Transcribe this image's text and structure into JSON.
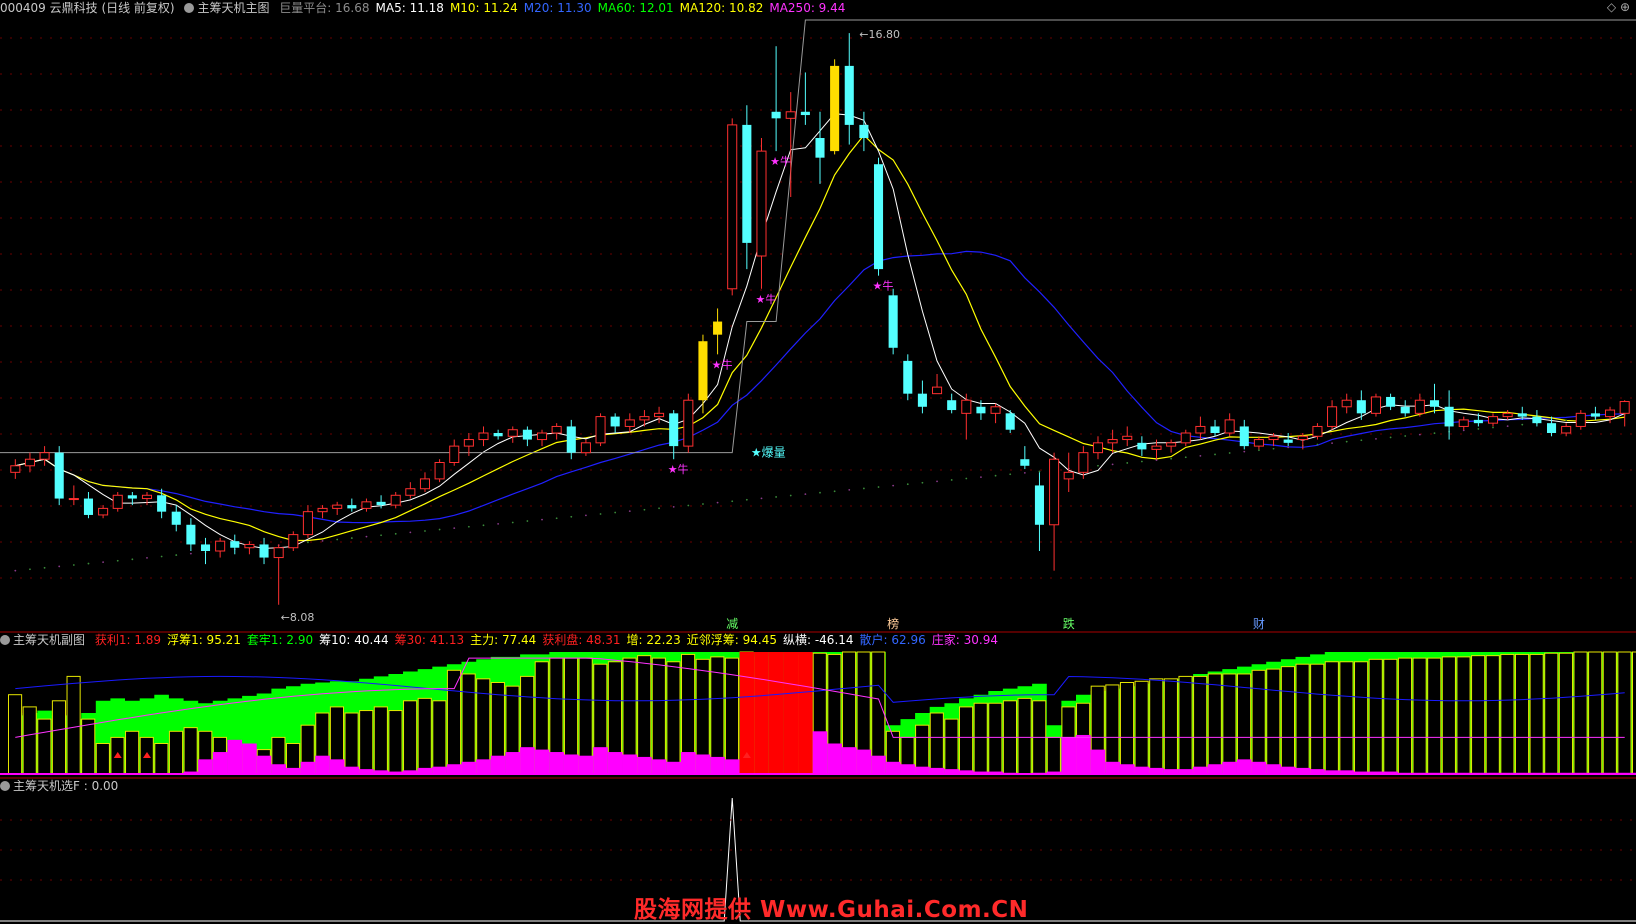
{
  "main_header": {
    "code_name": "000409 云鼎科技 (日线 前复权)",
    "indicator": "主筹天机主图",
    "items": [
      {
        "label": "巨量平台: 16.68",
        "color": "#8c8c8c"
      },
      {
        "label": "MA5: 11.18",
        "color": "#ffffff"
      },
      {
        "label": "M10: 11.24",
        "color": "#ffff00"
      },
      {
        "label": "M20: 11.30",
        "color": "#3366ff"
      },
      {
        "label": "MA60: 12.01",
        "color": "#00ff00"
      },
      {
        "label": "MA120: 10.82",
        "color": "#ffff00"
      },
      {
        "label": "MA250: 9.44",
        "color": "#ff33ff"
      }
    ]
  },
  "main_chart": {
    "high_label": "16.80",
    "low_label": "8.08",
    "volume_label": "爆量",
    "signal_label": "牛",
    "bottom_markers": [
      "减",
      "榜",
      "跌",
      "财"
    ]
  },
  "sub_header": {
    "indicator": "主筹天机副图",
    "items": [
      {
        "label": "获利1: 1.89",
        "color": "#ff2020"
      },
      {
        "label": "浮筹1: 95.21",
        "color": "#ffff00"
      },
      {
        "label": "套牢1: 2.90",
        "color": "#00ff00"
      },
      {
        "label": "筹10: 40.44",
        "color": "#ffffff"
      },
      {
        "label": "筹30: 41.13",
        "color": "#ff2020"
      },
      {
        "label": "主力: 77.44",
        "color": "#ffff00"
      },
      {
        "label": "获利盘: 48.31",
        "color": "#ff2020"
      },
      {
        "label": "增: 22.23",
        "color": "#ffff00"
      },
      {
        "label": "近邻浮筹: 94.45",
        "color": "#ffff00"
      },
      {
        "label": "纵横: -46.14",
        "color": "#ffffff"
      },
      {
        "label": "散户: 62.96",
        "color": "#3366ff"
      },
      {
        "label": "庄家: 30.94",
        "color": "#ff33ff"
      }
    ]
  },
  "sel_header": {
    "indicator": "主筹天机选F : 0.00"
  },
  "watermark": "股海网提供 Www.Guhai.Com.CN",
  "colors": {
    "up": "#ff3030",
    "down": "#54ffff",
    "ma5": "#ffffff",
    "ma10": "#ffff00",
    "ma20": "#2020ff",
    "platform": "#9a9a9a",
    "sub_green": "#00ff00",
    "sub_magenta": "#ff00ff",
    "sub_red": "#ff0000"
  },
  "chart_data": {
    "type": "candlestick",
    "ohlc": [
      [
        10.1,
        10.3,
        10.0,
        10.2
      ],
      [
        10.2,
        10.4,
        10.1,
        10.3
      ],
      [
        10.3,
        10.5,
        10.2,
        10.4
      ],
      [
        10.4,
        10.5,
        9.6,
        9.7
      ],
      [
        9.7,
        9.9,
        9.6,
        9.7
      ],
      [
        9.7,
        9.8,
        9.4,
        9.45
      ],
      [
        9.45,
        9.6,
        9.4,
        9.55
      ],
      [
        9.55,
        9.8,
        9.5,
        9.75
      ],
      [
        9.75,
        9.8,
        9.6,
        9.7
      ],
      [
        9.7,
        9.8,
        9.6,
        9.75
      ],
      [
        9.75,
        9.85,
        9.4,
        9.5
      ],
      [
        9.5,
        9.6,
        9.2,
        9.3
      ],
      [
        9.3,
        9.4,
        8.9,
        9.0
      ],
      [
        9.0,
        9.1,
        8.7,
        8.9
      ],
      [
        8.9,
        9.1,
        8.8,
        9.05
      ],
      [
        9.05,
        9.15,
        8.85,
        8.95
      ],
      [
        8.95,
        9.05,
        8.85,
        9.0
      ],
      [
        9.0,
        9.1,
        8.7,
        8.8
      ],
      [
        8.8,
        9.0,
        8.08,
        8.95
      ],
      [
        8.95,
        9.2,
        8.9,
        9.15
      ],
      [
        9.15,
        9.6,
        9.1,
        9.5
      ],
      [
        9.5,
        9.6,
        9.4,
        9.55
      ],
      [
        9.55,
        9.65,
        9.45,
        9.6
      ],
      [
        9.6,
        9.7,
        9.5,
        9.55
      ],
      [
        9.55,
        9.7,
        9.5,
        9.65
      ],
      [
        9.65,
        9.75,
        9.55,
        9.6
      ],
      [
        9.6,
        9.8,
        9.55,
        9.75
      ],
      [
        9.75,
        9.95,
        9.7,
        9.85
      ],
      [
        9.85,
        10.1,
        9.8,
        10.0
      ],
      [
        10.0,
        10.3,
        9.95,
        10.25
      ],
      [
        10.25,
        10.6,
        10.2,
        10.5
      ],
      [
        10.5,
        10.7,
        10.35,
        10.6
      ],
      [
        10.6,
        10.8,
        10.5,
        10.7
      ],
      [
        10.7,
        10.75,
        10.6,
        10.65
      ],
      [
        10.65,
        10.8,
        10.55,
        10.75
      ],
      [
        10.75,
        10.8,
        10.5,
        10.6
      ],
      [
        10.6,
        10.75,
        10.5,
        10.7
      ],
      [
        10.7,
        10.85,
        10.6,
        10.8
      ],
      [
        10.8,
        10.9,
        10.3,
        10.4
      ],
      [
        10.4,
        10.6,
        10.35,
        10.55
      ],
      [
        10.55,
        11.0,
        10.5,
        10.95
      ],
      [
        10.95,
        11.0,
        10.7,
        10.8
      ],
      [
        10.8,
        11.0,
        10.7,
        10.9
      ],
      [
        10.9,
        11.05,
        10.8,
        10.95
      ],
      [
        10.95,
        11.1,
        10.85,
        11.0
      ],
      [
        11.0,
        11.05,
        10.3,
        10.5
      ],
      [
        10.5,
        11.3,
        10.4,
        11.2
      ],
      [
        11.2,
        12.2,
        11.0,
        12.1
      ],
      [
        12.2,
        12.6,
        11.9,
        12.4
      ],
      [
        12.9,
        15.5,
        12.8,
        15.4
      ],
      [
        15.4,
        15.7,
        13.2,
        13.6
      ],
      [
        13.4,
        15.2,
        12.9,
        15.0
      ],
      [
        15.6,
        16.6,
        15.0,
        15.5
      ],
      [
        15.5,
        15.9,
        14.3,
        15.6
      ],
      [
        15.6,
        16.2,
        15.4,
        15.55
      ],
      [
        15.2,
        15.6,
        14.5,
        14.9
      ],
      [
        15.0,
        16.4,
        14.95,
        16.3
      ],
      [
        16.3,
        16.8,
        15.1,
        15.4
      ],
      [
        15.4,
        15.6,
        15.0,
        15.2
      ],
      [
        14.8,
        14.9,
        13.1,
        13.2
      ],
      [
        12.8,
        12.9,
        11.9,
        12.0
      ],
      [
        11.8,
        11.9,
        11.2,
        11.3
      ],
      [
        11.3,
        11.5,
        11.0,
        11.1
      ],
      [
        11.3,
        11.6,
        11.3,
        11.4
      ],
      [
        11.2,
        11.3,
        11.0,
        11.05
      ],
      [
        11.0,
        11.3,
        10.6,
        11.2
      ],
      [
        11.1,
        11.2,
        10.9,
        11.0
      ],
      [
        11.0,
        11.15,
        10.85,
        11.1
      ],
      [
        11.0,
        11.05,
        10.7,
        10.75
      ],
      [
        10.3,
        10.5,
        10.15,
        10.2
      ],
      [
        9.9,
        10.1,
        8.9,
        9.3
      ],
      [
        9.3,
        10.4,
        8.6,
        10.3
      ],
      [
        10.0,
        10.4,
        9.8,
        10.1
      ],
      [
        10.1,
        10.5,
        10.0,
        10.4
      ],
      [
        10.4,
        10.65,
        10.3,
        10.55
      ],
      [
        10.55,
        10.75,
        10.4,
        10.6
      ],
      [
        10.6,
        10.8,
        10.5,
        10.65
      ],
      [
        10.55,
        10.65,
        10.35,
        10.45
      ],
      [
        10.45,
        10.6,
        10.3,
        10.5
      ],
      [
        10.5,
        10.6,
        10.4,
        10.55
      ],
      [
        10.55,
        10.75,
        10.5,
        10.7
      ],
      [
        10.7,
        10.95,
        10.6,
        10.8
      ],
      [
        10.8,
        10.9,
        10.65,
        10.7
      ],
      [
        10.7,
        11.0,
        10.65,
        10.9
      ],
      [
        10.8,
        10.9,
        10.45,
        10.5
      ],
      [
        10.5,
        10.65,
        10.45,
        10.6
      ],
      [
        10.6,
        10.7,
        10.5,
        10.65
      ],
      [
        10.6,
        10.7,
        10.5,
        10.55
      ],
      [
        10.6,
        10.7,
        10.45,
        10.65
      ],
      [
        10.65,
        10.85,
        10.6,
        10.8
      ],
      [
        10.8,
        11.2,
        10.75,
        11.1
      ],
      [
        11.1,
        11.3,
        11.0,
        11.2
      ],
      [
        11.2,
        11.35,
        10.9,
        11.0
      ],
      [
        11.0,
        11.3,
        10.95,
        11.25
      ],
      [
        11.25,
        11.3,
        11.05,
        11.1
      ],
      [
        11.1,
        11.2,
        10.95,
        11.0
      ],
      [
        11.0,
        11.3,
        10.95,
        11.2
      ],
      [
        11.2,
        11.45,
        11.0,
        11.1
      ],
      [
        11.1,
        11.35,
        10.6,
        10.8
      ],
      [
        10.8,
        10.95,
        10.75,
        10.9
      ],
      [
        10.9,
        11.0,
        10.8,
        10.85
      ],
      [
        10.85,
        11.0,
        10.8,
        10.95
      ],
      [
        10.95,
        11.05,
        10.9,
        11.0
      ],
      [
        11.0,
        11.1,
        10.9,
        10.95
      ],
      [
        10.95,
        11.05,
        10.8,
        10.85
      ],
      [
        10.85,
        10.95,
        10.65,
        10.7
      ],
      [
        10.7,
        10.85,
        10.65,
        10.8
      ],
      [
        10.8,
        11.05,
        10.75,
        11.0
      ],
      [
        11.0,
        11.1,
        10.9,
        10.95
      ],
      [
        10.95,
        11.1,
        10.85,
        11.05
      ],
      [
        11.0,
        11.2,
        10.8,
        11.18
      ]
    ],
    "ylim": [
      8.0,
      17.0
    ],
    "volume_bars": [
      65,
      55,
      45,
      60,
      80,
      45,
      25,
      30,
      35,
      30,
      25,
      35,
      38,
      35,
      30,
      25,
      22,
      20,
      30,
      25,
      40,
      50,
      55,
      50,
      52,
      55,
      52,
      60,
      62,
      60,
      85,
      82,
      78,
      75,
      72,
      80,
      92,
      95,
      95,
      95,
      90,
      92,
      95,
      97,
      95,
      92,
      98,
      94,
      96,
      95,
      100,
      96,
      96,
      98,
      97,
      99,
      98,
      100,
      100,
      100,
      35,
      30,
      40,
      50,
      45,
      55,
      58,
      58,
      60,
      62,
      60,
      30,
      55,
      58,
      72,
      73,
      75,
      76,
      78,
      78,
      80,
      80,
      82,
      82,
      82,
      85,
      86,
      88,
      90,
      90,
      92,
      92,
      92,
      94,
      94,
      95,
      95,
      95,
      96,
      96,
      97,
      97,
      98,
      98,
      98,
      99,
      99,
      100,
      100,
      100,
      100,
      100,
      100
    ],
    "green_floor": [
      48,
      50,
      52,
      48,
      45,
      50,
      60,
      62,
      60,
      62,
      65,
      62,
      60,
      58,
      60,
      62,
      64,
      66,
      70,
      72,
      74,
      75,
      76,
      76,
      78,
      80,
      82,
      84,
      86,
      88,
      90,
      92,
      94,
      96,
      96,
      98,
      98,
      100,
      100,
      100,
      100,
      100,
      100,
      100,
      100,
      100,
      100,
      100,
      100,
      100,
      100,
      100,
      100,
      100,
      100,
      100,
      100,
      100,
      100,
      100,
      40,
      45,
      50,
      55,
      58,
      62,
      65,
      68,
      70,
      72,
      74,
      40,
      60,
      65,
      68,
      70,
      72,
      74,
      76,
      78,
      80,
      82,
      84,
      86,
      88,
      90,
      92,
      94,
      96,
      98,
      100,
      100,
      100,
      100,
      100,
      100,
      100,
      100,
      100,
      100,
      100,
      100,
      100,
      100,
      100,
      100,
      100,
      100,
      100,
      100,
      100,
      100,
      100
    ],
    "magenta_area": [
      0,
      0,
      0,
      0,
      0,
      0,
      0,
      0,
      0,
      0,
      0,
      0,
      2,
      12,
      18,
      28,
      25,
      15,
      8,
      5,
      10,
      15,
      12,
      6,
      4,
      3,
      2,
      3,
      5,
      6,
      8,
      10,
      12,
      15,
      18,
      22,
      20,
      18,
      16,
      15,
      22,
      18,
      16,
      14,
      12,
      10,
      18,
      16,
      14,
      12,
      100,
      100,
      100,
      100,
      100,
      35,
      25,
      22,
      20,
      15,
      10,
      8,
      6,
      5,
      4,
      3,
      2,
      2,
      1,
      0,
      1,
      2,
      30,
      32,
      20,
      10,
      8,
      6,
      5,
      4,
      4,
      6,
      8,
      10,
      12,
      10,
      8,
      6,
      5,
      4,
      3,
      3,
      2,
      2,
      2,
      1,
      1,
      1,
      1,
      1,
      1,
      1,
      1,
      1,
      1,
      1,
      1,
      1,
      1,
      1,
      1,
      1,
      1
    ],
    "sel_peak_index": 49
  }
}
